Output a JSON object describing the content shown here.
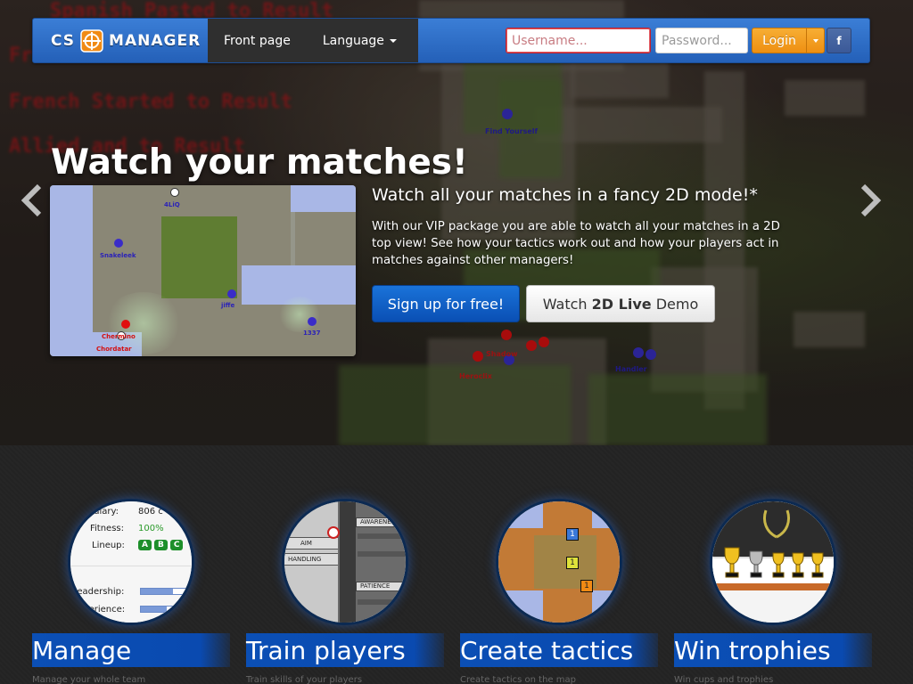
{
  "colors": {
    "nav_blue": "#2460b8",
    "login_orange": "#ee8f12",
    "signup_blue": "#0a4fb4",
    "feature_bar": "#0b4fb5"
  },
  "navbar": {
    "brand_left": "CS",
    "brand_right": "MANAGER",
    "logo_icon": "crosshair-logo-icon",
    "menu": [
      {
        "label": "Front page"
      },
      {
        "label": "Language"
      }
    ],
    "username_placeholder": "Username...",
    "password_placeholder": "Password...",
    "login_label": "Login",
    "facebook_label": "f"
  },
  "hero": {
    "title": "Watch your matches!",
    "caption_title": "Watch all your matches in a fancy 2D mode!*",
    "caption_text": "With our VIP package you are able to watch all your matches in a 2D top view! See how your tactics work out and how your players act in matches against other managers!",
    "signup_label": "Sign up for free!",
    "demo_label_pre": "Watch ",
    "demo_label_bold": "2D Live",
    "demo_label_post": " Demo",
    "background_red_text": [
      "Spanish Pasted to Result",
      "French Pasted to Result",
      "French Started to Result",
      "Allied and to Result"
    ],
    "preview_labels": {
      "top": "4LiQ",
      "p1": "Snakeleek",
      "p2": "jiffe",
      "p3": "1337",
      "r1": "Chermino",
      "r2": "Chordatar"
    }
  },
  "features": [
    {
      "title": "Manage",
      "sub": "Manage your whole team"
    },
    {
      "title": "Train players",
      "sub": "Train skills of your players"
    },
    {
      "title": "Create tactics",
      "sub": "Create tactics on the map"
    },
    {
      "title": "Win trophies",
      "sub": "Win cups and trophies"
    }
  ],
  "manage_card": {
    "salary_label": "Salary:",
    "salary_value": "806 c",
    "fitness_label": "Fitness:",
    "fitness_value": "100%",
    "lineup_label": "Lineup:",
    "lineup_badges": [
      "A",
      "B",
      "C"
    ],
    "leadership_label": "Leadership:",
    "experience_label": "Experience:"
  },
  "train_card": {
    "labels": [
      "AIM",
      "HANDLING",
      "AWARENESS",
      "PATIENCE"
    ]
  },
  "tactics_card": {
    "markers": [
      "1",
      "1",
      "1"
    ]
  }
}
